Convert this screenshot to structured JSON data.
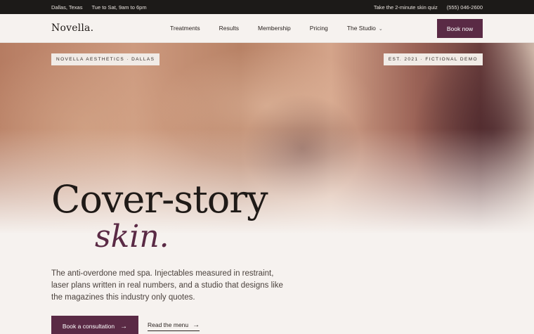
{
  "topbar": {
    "location": "Dallas, Texas",
    "hours": "Tue to Sat, 9am to 6pm",
    "quiz_link": "Take the 2-minute skin quiz",
    "phone": "(555) 046-2600"
  },
  "nav": {
    "logo": "Novella.",
    "items": [
      "Treatments",
      "Results",
      "Membership",
      "Pricing",
      "The Studio"
    ],
    "book_label": "Book now"
  },
  "hero": {
    "badge_left": "NOVELLA AESTHETICS · DALLAS",
    "badge_right": "EST. 2021 · FICTIONAL DEMO",
    "headline_line1": "Cover-story",
    "headline_line2": "skin.",
    "description": "The anti-overdone med spa. Injectables measured in restraint, laser plans written in real numbers, and a studio that designs like the magazines this industry only quotes.",
    "cta_primary": "Book a consultation",
    "cta_secondary": "Read the menu",
    "arrow": "→"
  },
  "colors": {
    "accent": "#5a2a45",
    "topbar_bg": "#1c1a18",
    "page_bg": "#f6f2ef"
  }
}
